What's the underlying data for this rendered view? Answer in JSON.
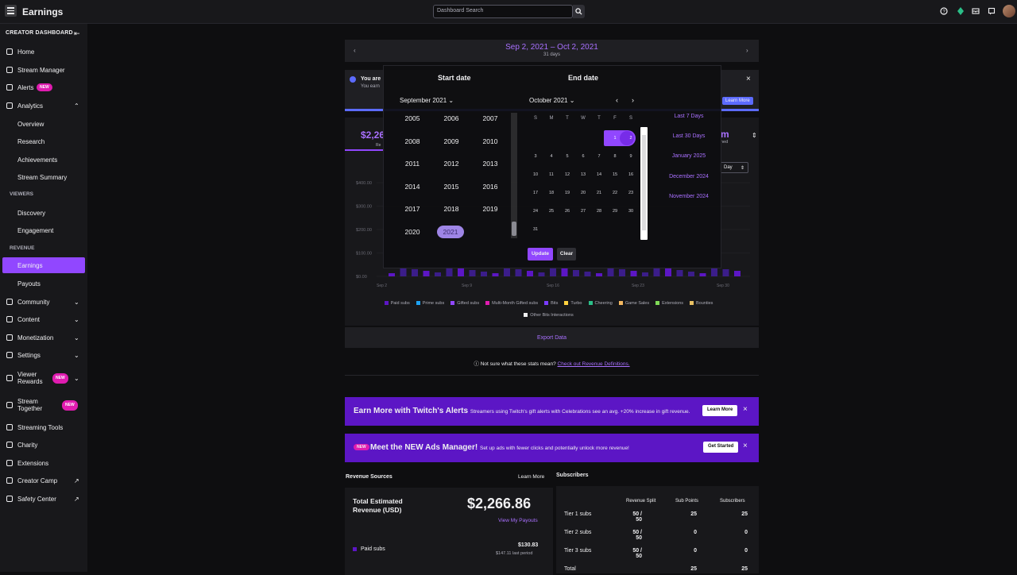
{
  "app": {
    "title": "Earnings"
  },
  "search": {
    "placeholder": "Dashboard Search"
  },
  "sidebar": {
    "header": "CREATOR DASHBOARD",
    "items": [
      {
        "label": "Home"
      },
      {
        "label": "Stream Manager"
      },
      {
        "label": "Alerts",
        "badge": "NEW"
      },
      {
        "label": "Analytics"
      },
      {
        "label": "Overview"
      },
      {
        "label": "Research"
      },
      {
        "label": "Achievements"
      },
      {
        "label": "Stream Summary"
      },
      {
        "label": "VIEWERS"
      },
      {
        "label": "Discovery"
      },
      {
        "label": "Engagement"
      },
      {
        "label": "REVENUE"
      },
      {
        "label": "Earnings"
      },
      {
        "label": "Payouts"
      },
      {
        "label": "Community"
      },
      {
        "label": "Content"
      },
      {
        "label": "Monetization"
      },
      {
        "label": "Settings"
      },
      {
        "label": "Viewer Rewards",
        "badge": "NEW"
      },
      {
        "label": "Stream Together",
        "badge": "NEW"
      },
      {
        "label": "Streaming Tools"
      },
      {
        "label": "Charity"
      },
      {
        "label": "Extensions"
      },
      {
        "label": "Creator Camp"
      },
      {
        "label": "Safety Center"
      }
    ]
  },
  "date_header": {
    "range": "Sep 2, 2021 – Oct 2, 2021",
    "days": "31 days"
  },
  "notice": {
    "text_line1": "You are",
    "text_line2": "You earn",
    "learn_more": "Learn More"
  },
  "stats": {
    "revenue_partial": "$2,26",
    "revenue_sub": "Re",
    "right_partial": "m",
    "right_sub": "ned",
    "granularity": "Day"
  },
  "chart_data": {
    "type": "bar",
    "y_ticks": [
      "$400.00",
      "$300.00",
      "$200.00",
      "$100.00",
      "$0.00"
    ],
    "x_ticks": [
      "Sep 2",
      "Sep 9",
      "Sep 16",
      "Sep 23",
      "Sep 30"
    ],
    "series": [
      {
        "name": "Paid subs",
        "color": "#5c16c5"
      },
      {
        "name": "Prime subs",
        "color": "#1da1f2"
      },
      {
        "name": "Gifted subs",
        "color": "#9147ff"
      },
      {
        "name": "Multi-Month Gifted subs",
        "color": "#e01cb0"
      },
      {
        "name": "Bits",
        "color": "#7a3cff"
      },
      {
        "name": "Turbo",
        "color": "#ffd23f"
      },
      {
        "name": "Cheering",
        "color": "#2bbf88"
      },
      {
        "name": "Game Sales",
        "color": "#f4b860"
      },
      {
        "name": "Extensions",
        "color": "#7fd957"
      },
      {
        "name": "Bounties",
        "color": "#e8c063"
      },
      {
        "name": "Other Bits Interactions",
        "color": "#efeff1"
      }
    ]
  },
  "picker": {
    "start_title": "Start date",
    "end_title": "End date",
    "start_month": "September 2021",
    "end_month": "October 2021",
    "years": [
      "2005",
      "2006",
      "2007",
      "2008",
      "2009",
      "2010",
      "2011",
      "2012",
      "2013",
      "2014",
      "2015",
      "2016",
      "2017",
      "2018",
      "2019",
      "2020",
      "2021"
    ],
    "selected_year": "2021",
    "dow": [
      "S",
      "M",
      "T",
      "W",
      "T",
      "F",
      "S"
    ],
    "weeks": [
      [
        "",
        "",
        "",
        "",
        "",
        "1",
        "2"
      ],
      [
        "3",
        "4",
        "5",
        "6",
        "7",
        "8",
        "9"
      ],
      [
        "10",
        "11",
        "12",
        "13",
        "14",
        "15",
        "16"
      ],
      [
        "17",
        "18",
        "19",
        "20",
        "21",
        "22",
        "23"
      ],
      [
        "24",
        "25",
        "26",
        "27",
        "28",
        "29",
        "30"
      ],
      [
        "31",
        "",
        "",
        "",
        "",
        "",
        ""
      ]
    ],
    "quick": [
      "Last 7 Days",
      "Last 30 Days",
      "January 2025",
      "December 2024",
      "November 2024"
    ],
    "update": "Update",
    "clear": "Clear"
  },
  "export": {
    "label": "Export Data"
  },
  "definitions": {
    "text": "Not sure what these stats mean?",
    "link": "Check out Revenue Definitions."
  },
  "promos": [
    {
      "title": "Earn More with Twitch's Alerts",
      "text": "Streamers using Twitch's gift alerts with Celebrations see an avg. +20% increase in gift revenue.",
      "button": "Learn More"
    },
    {
      "tag": "NEW",
      "title": "Meet the NEW Ads Manager!",
      "text": "Set up ads with fewer clicks and potentially unlock more revenue!",
      "button": "Get Started"
    }
  ],
  "revenue_sources": {
    "title": "Revenue Sources",
    "learn_more": "Learn More",
    "total_label": "Total Estimated Revenue (USD)",
    "total_value": "$2,266.86",
    "payouts_link": "View My Payouts",
    "rows": [
      {
        "label": "Paid subs",
        "value": "$130.83",
        "sub": "$147.11 last period"
      }
    ]
  },
  "subscribers": {
    "title": "Subscribers",
    "columns": [
      "Revenue Split",
      "Sub Points",
      "Subscribers"
    ],
    "rows": [
      {
        "tier": "Tier 1 subs",
        "split": "50 / 50",
        "points": "25",
        "subs": "25"
      },
      {
        "tier": "Tier 2 subs",
        "split": "50 / 50",
        "points": "0",
        "subs": "0"
      },
      {
        "tier": "Tier 3 subs",
        "split": "50 / 50",
        "points": "0",
        "subs": "0"
      },
      {
        "tier": "Total",
        "split": "",
        "points": "25",
        "subs": "25"
      }
    ]
  }
}
